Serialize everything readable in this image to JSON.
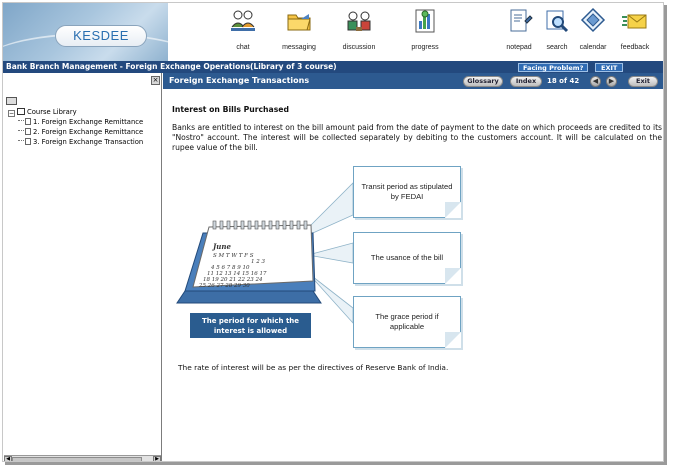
{
  "app": {
    "brand": "KESDEE"
  },
  "toolbar": {
    "items": [
      {
        "id": "chat",
        "label": "chat",
        "icon": "chat-icon"
      },
      {
        "id": "messaging",
        "label": "messaging",
        "icon": "folder-messaging-icon"
      },
      {
        "id": "discussion",
        "label": "discussion",
        "icon": "discussion-icon"
      },
      {
        "id": "progress",
        "label": "progress",
        "icon": "progress-icon"
      },
      {
        "id": "notepad",
        "label": "notepad",
        "icon": "notepad-icon"
      },
      {
        "id": "search",
        "label": "search",
        "icon": "search-icon"
      },
      {
        "id": "calendar",
        "label": "calendar",
        "icon": "calendar-icon"
      },
      {
        "id": "feedback",
        "label": "feedback",
        "icon": "feedback-icon"
      }
    ]
  },
  "header": {
    "course_title": "Bank Branch Management - Foreign Exchange Operations(Library of 3 course)",
    "facing_problem": "Facing Problem?",
    "exit": "EXIT"
  },
  "sidebar": {
    "root_label": "Course Library",
    "items": [
      {
        "label": "1. Foreign Exchange Remittance"
      },
      {
        "label": "2. Foreign Exchange Remittance"
      },
      {
        "label": "3. Foreign Exchange Transaction"
      }
    ],
    "close_glyph": "×"
  },
  "lesson": {
    "title": "Foreign Exchange Transactions",
    "glossary": "Glossary",
    "index": "Index",
    "page_indicator": "18 of 42",
    "exit": "Exit",
    "heading": "Interest on Bills Purchased",
    "paragraph": "Banks are entitled to interest on the bill amount paid from the date of payment to the date on which proceeds are credited to its \"Nostro\" account. The interest will be collected separately by debiting to the customers account. It will be calculated on the rupee value of the bill.",
    "footnote": "The rate of interest will be as per the directives of Reserve Bank of India."
  },
  "diagram": {
    "calendar_month": "June",
    "weekdays": [
      "S",
      "M",
      "T",
      "W",
      "T",
      "F",
      "S"
    ],
    "caption": "The period for which the interest is allowed",
    "cards": [
      {
        "text": "Transit period as stipulated by FEDAI"
      },
      {
        "text": "The usance of the bill"
      },
      {
        "text": "The grace period if applicable"
      }
    ]
  },
  "colors": {
    "header_blue": "#23497e",
    "lesson_bar": "#2d5a90",
    "caption_blue": "#2a5c8f",
    "card_border": "#6fa3c3"
  }
}
